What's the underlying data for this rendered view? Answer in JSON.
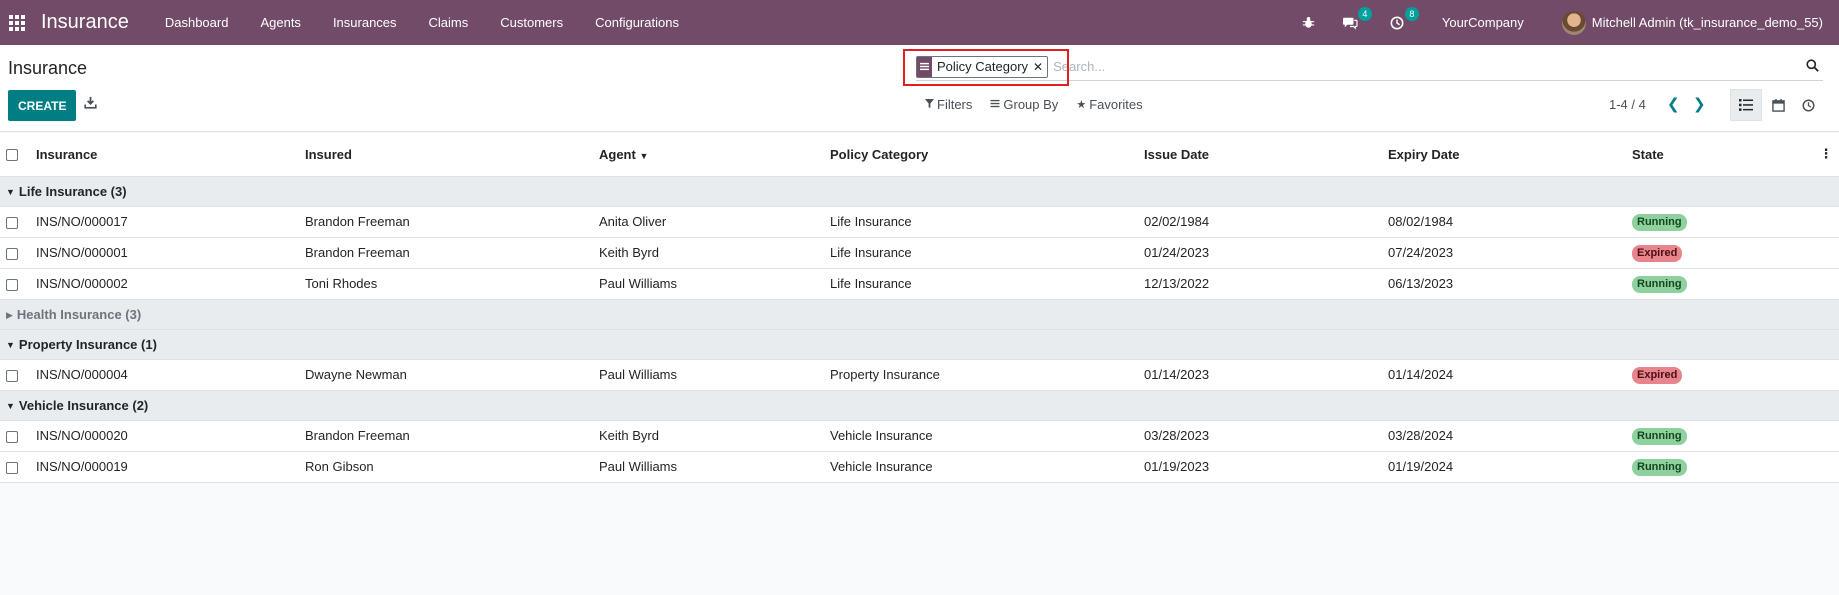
{
  "navbar": {
    "brand": "Insurance",
    "menu": [
      "Dashboard",
      "Agents",
      "Insurances",
      "Claims",
      "Customers",
      "Configurations"
    ],
    "messages_count": "4",
    "activities_count": "8",
    "company": "YourCompany",
    "user": "Mitchell Admin (tk_insurance_demo_55)"
  },
  "control_panel": {
    "title": "Insurance",
    "facet_label": "Policy Category",
    "search_placeholder": "Search...",
    "create_label": "CREATE",
    "filters_label": "Filters",
    "groupby_label": "Group By",
    "favorites_label": "Favorites",
    "pager": "1-4 / 4"
  },
  "table": {
    "columns": [
      "Insurance",
      "Insured",
      "Agent",
      "Policy Category",
      "Issue Date",
      "Expiry Date",
      "State"
    ],
    "groups": [
      {
        "label": "Life Insurance (3)",
        "expanded": true,
        "rows": [
          [
            "INS/NO/000017",
            "Brandon Freeman",
            "Anita Oliver",
            "Life Insurance",
            "02/02/1984",
            "08/02/1984",
            "Running"
          ],
          [
            "INS/NO/000001",
            "Brandon Freeman",
            "Keith Byrd",
            "Life Insurance",
            "01/24/2023",
            "07/24/2023",
            "Expired"
          ],
          [
            "INS/NO/000002",
            "Toni Rhodes",
            "Paul Williams",
            "Life Insurance",
            "12/13/2022",
            "06/13/2023",
            "Running"
          ]
        ]
      },
      {
        "label": "Health Insurance (3)",
        "expanded": false,
        "rows": []
      },
      {
        "label": "Property Insurance (1)",
        "expanded": true,
        "rows": [
          [
            "INS/NO/000004",
            "Dwayne Newman",
            "Paul Williams",
            "Property Insurance",
            "01/14/2023",
            "01/14/2024",
            "Expired"
          ]
        ]
      },
      {
        "label": "Vehicle Insurance (2)",
        "expanded": true,
        "rows": [
          [
            "INS/NO/000020",
            "Brandon Freeman",
            "Keith Byrd",
            "Vehicle Insurance",
            "03/28/2023",
            "03/28/2024",
            "Running"
          ],
          [
            "INS/NO/000019",
            "Ron Gibson",
            "Paul Williams",
            "Vehicle Insurance",
            "01/19/2023",
            "01/19/2024",
            "Running"
          ]
        ]
      }
    ]
  },
  "colors": {
    "brand": "#714b67",
    "primary": "#017e84",
    "running": "#8fd19e",
    "expired": "#e8848c"
  }
}
